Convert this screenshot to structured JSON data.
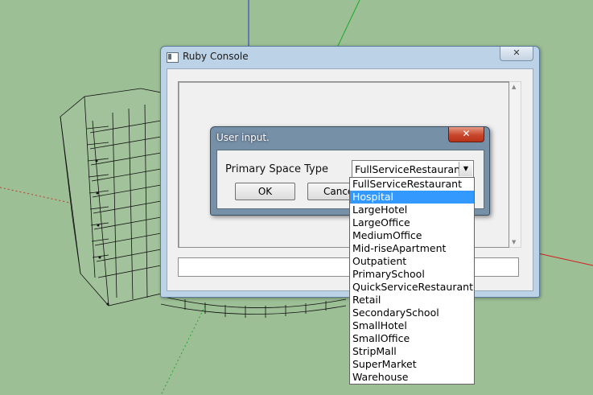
{
  "console_window": {
    "title": "Ruby Console",
    "close_glyph": "✕"
  },
  "dialog": {
    "title": "User input.",
    "close_glyph": "✕",
    "prompt_label": "Primary Space Type",
    "selected_value": "FullServiceRestaurant",
    "ok_label": "OK",
    "cancel_label": "Cancel"
  },
  "dropdown": {
    "highlighted": "Hospital",
    "options": [
      "FullServiceRestaurant",
      "Hospital",
      "LargeHotel",
      "LargeOffice",
      "MediumOffice",
      "Mid-riseApartment",
      "Outpatient",
      "PrimarySchool",
      "QuickServiceRestaurant",
      "Retail",
      "SecondarySchool",
      "SmallHotel",
      "SmallOffice",
      "StripMall",
      "SuperMarket",
      "Warehouse"
    ]
  },
  "colors": {
    "viewport_background": "#9dbf96",
    "selection_highlight": "#3399ff",
    "dialog_close_red": "#c8462b"
  }
}
